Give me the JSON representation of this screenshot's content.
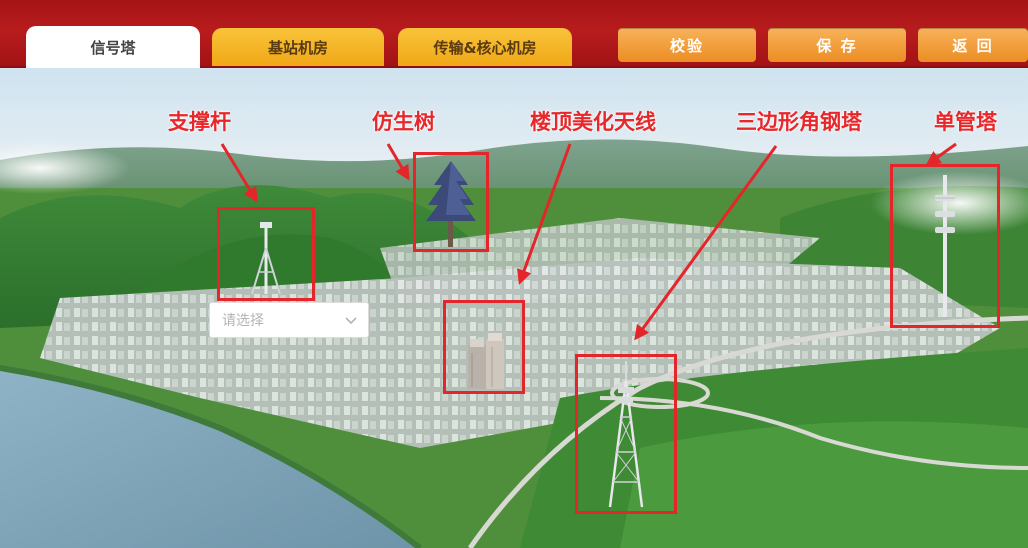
{
  "tabs": [
    {
      "label": "信号塔",
      "active": true
    },
    {
      "label": "基站机房",
      "active": false
    },
    {
      "label": "传输&核心机房",
      "active": false
    }
  ],
  "actions": {
    "verify_label": "校验",
    "save_label": "保 存",
    "back_label": "返 回"
  },
  "tower_types": [
    {
      "label": "支撑杆",
      "icon": "support-pole-icon"
    },
    {
      "label": "仿生树",
      "icon": "bionic-tree-icon"
    },
    {
      "label": "楼顶美化天线",
      "icon": "rooftop-camouflaged-antenna-icon"
    },
    {
      "label": "三边形角钢塔",
      "icon": "triangular-angle-steel-tower-icon"
    },
    {
      "label": "单管塔",
      "icon": "monopole-tower-icon"
    }
  ],
  "select": {
    "placeholder": "请选择"
  },
  "colors": {
    "header_red": "#b81c1d",
    "tab_yellow": "#f0a817",
    "button_orange": "#ec8d23",
    "annotation_red": "#e4252a"
  }
}
